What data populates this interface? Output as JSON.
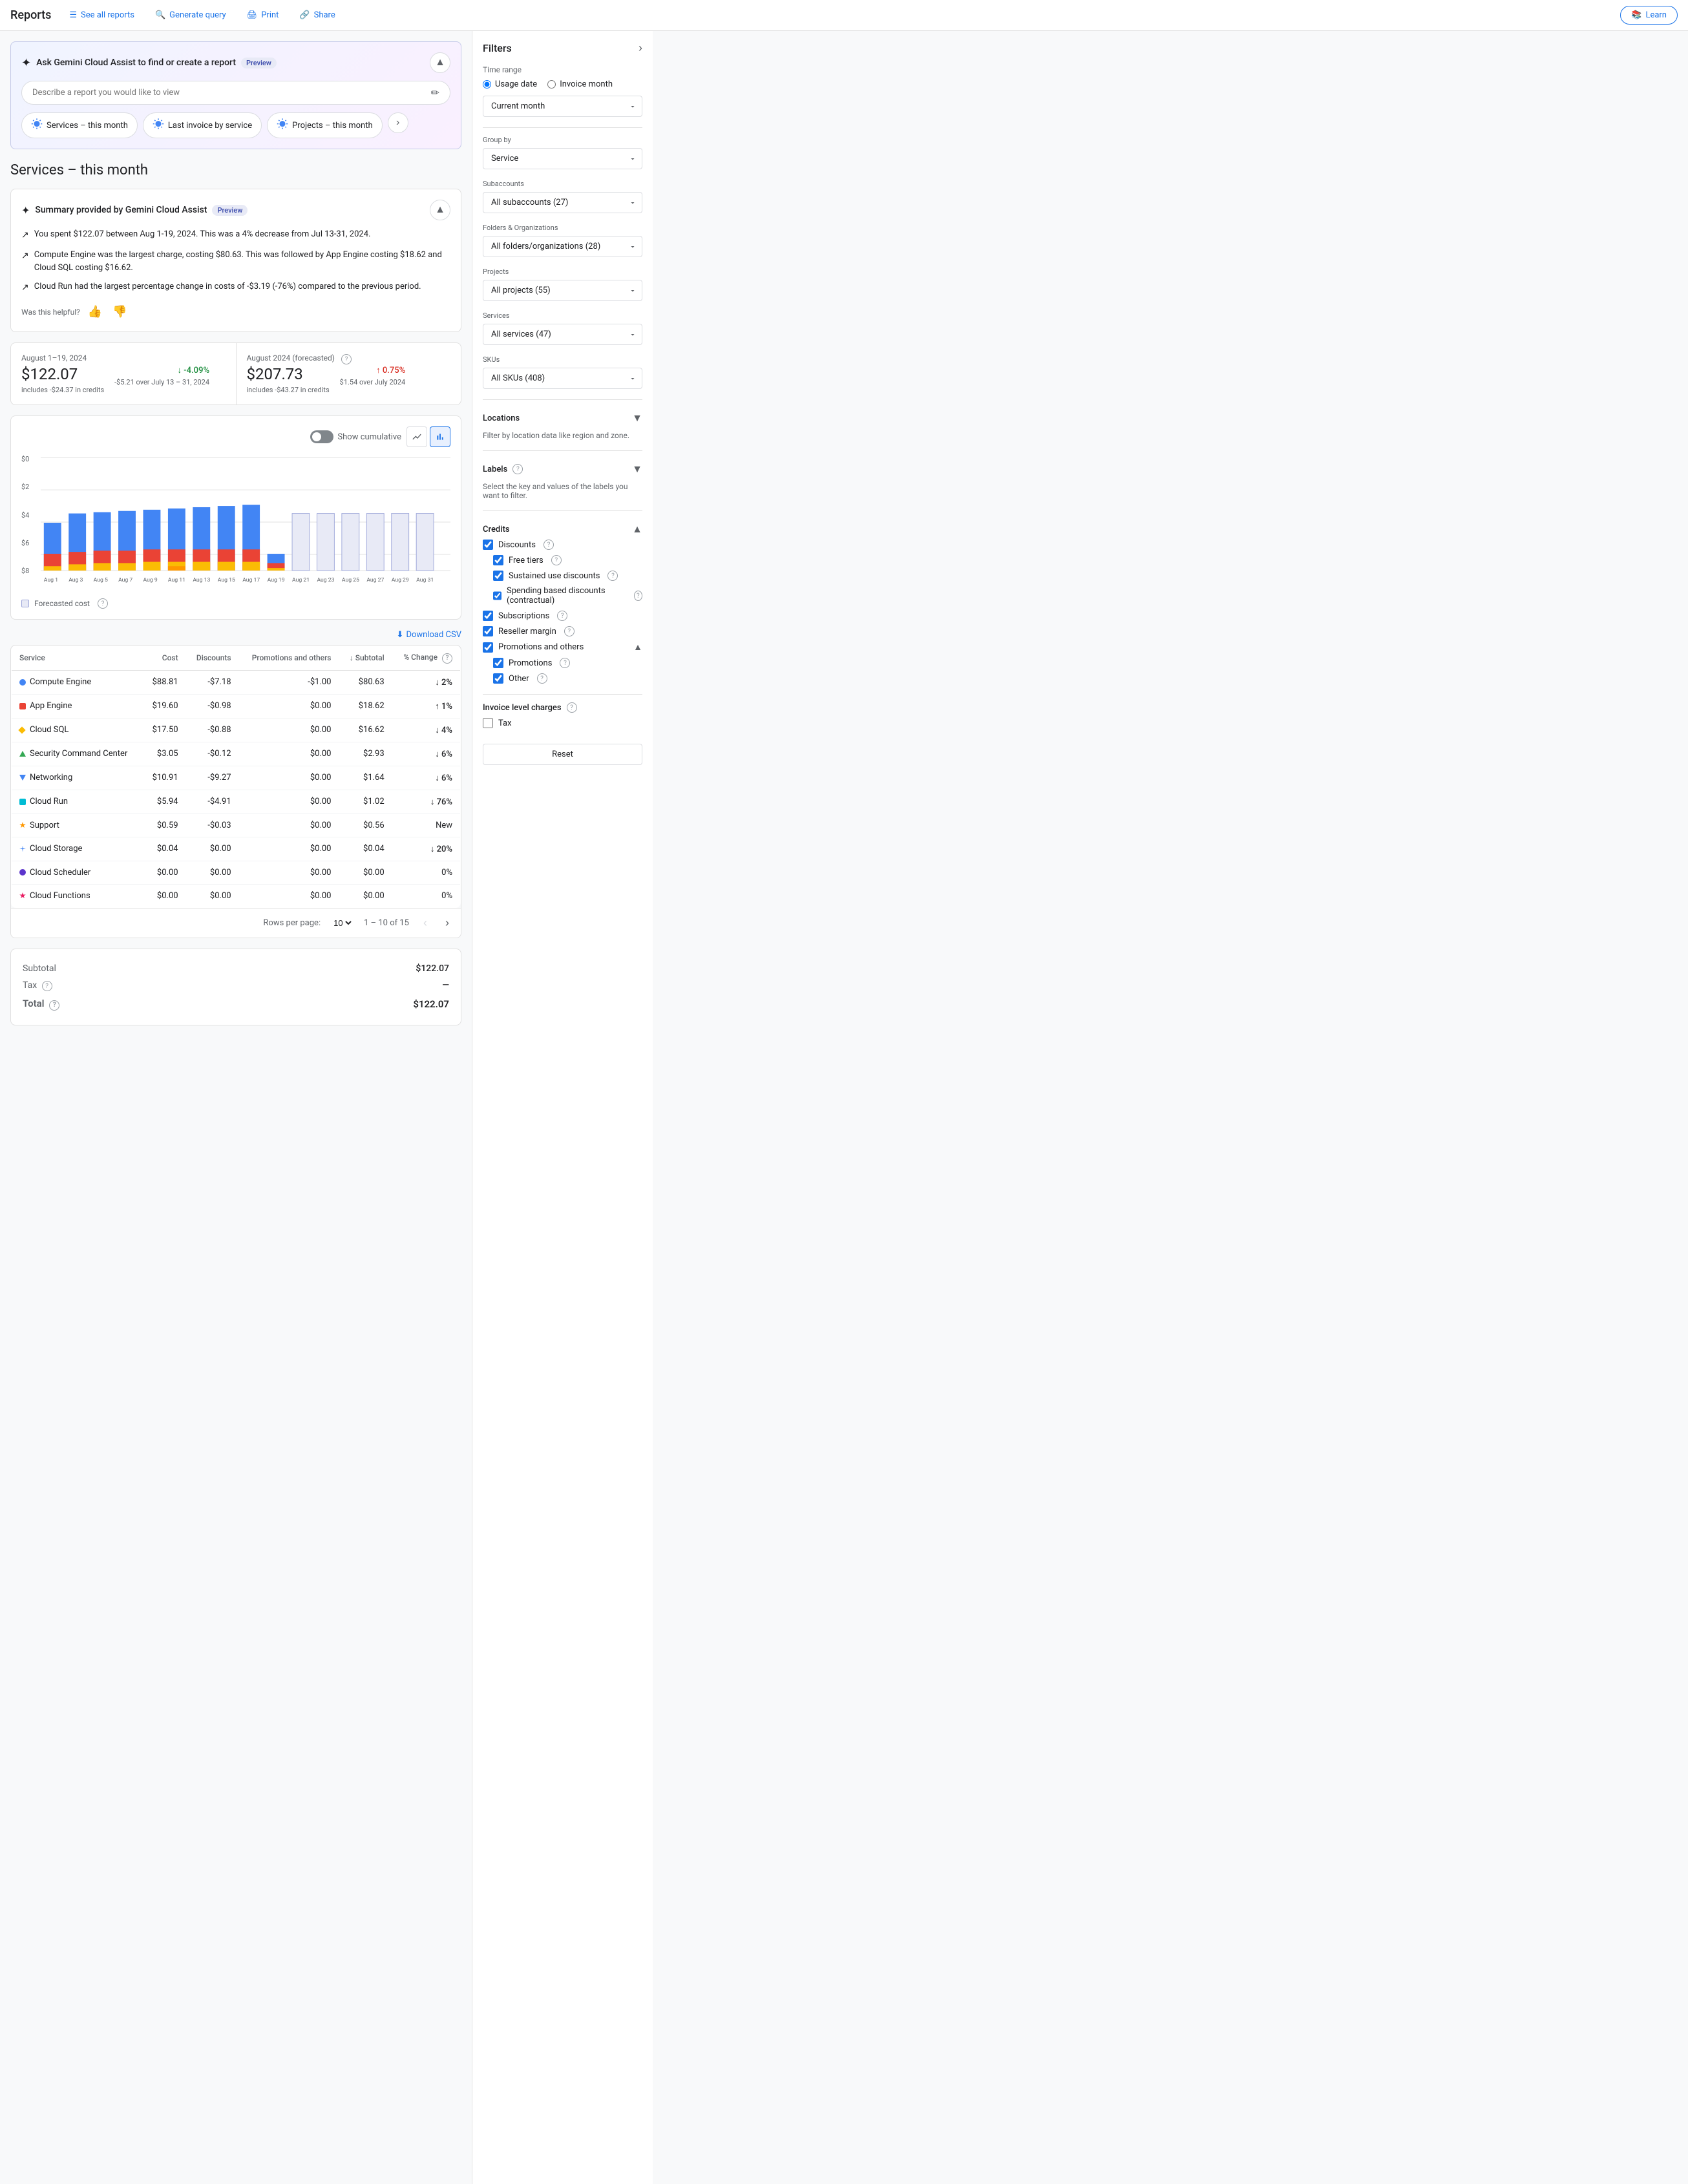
{
  "nav": {
    "title": "Reports",
    "see_all": "See all reports",
    "generate": "Generate query",
    "print": "Print",
    "share": "Share",
    "learn": "Learn"
  },
  "gemini": {
    "title": "Ask Gemini Cloud Assist to find or create a report",
    "badge": "Preview",
    "placeholder": "Describe a report you would like to view",
    "quick_links": [
      {
        "label": "Services – this month",
        "icon": "☁"
      },
      {
        "label": "Last invoice by service",
        "icon": "☁"
      },
      {
        "label": "Projects – this month",
        "icon": "☁"
      }
    ]
  },
  "page_title": "Services – this month",
  "summary": {
    "title": "Summary provided by Gemini Cloud Assist",
    "badge": "Preview",
    "bullets": [
      "You spent $122.07 between Aug 1-19, 2024. This was a 4% decrease from Jul 13-31, 2024.",
      "Compute Engine was the largest charge, costing $80.63. This was followed by App Engine costing $18.62 and Cloud SQL costing $16.62.",
      "Cloud Run had the largest percentage change in costs of -$3.19 (-76%) compared to the previous period."
    ],
    "helpful_label": "Was this helpful?"
  },
  "stats": {
    "current": {
      "date": "August 1–19, 2024",
      "amount": "$122.07",
      "sub": "includes -$24.37 in credits",
      "change": "↓ -4.09%",
      "change_dir": "down",
      "change_sub": "-$5.21 over July 13 – 31, 2024"
    },
    "forecast": {
      "date": "August 2024 (forecasted)",
      "amount": "$207.73",
      "sub": "includes -$43.27 in credits",
      "change": "↑ 0.75%",
      "change_dir": "up",
      "change_sub": "$1.54 over July 2024"
    }
  },
  "chart": {
    "y_labels": [
      "$8",
      "$6",
      "$4",
      "$2",
      "$0"
    ],
    "x_labels": [
      "Aug 1",
      "Aug 3",
      "Aug 5",
      "Aug 7",
      "Aug 9",
      "Aug 11",
      "Aug 13",
      "Aug 15",
      "Aug 17",
      "Aug 19",
      "Aug 21",
      "Aug 23",
      "Aug 25",
      "Aug 27",
      "Aug 29",
      "Aug 31"
    ],
    "show_cumulative": "Show cumulative",
    "legend_forecasted": "Forecasted cost",
    "download_csv": "Download CSV"
  },
  "table": {
    "headers": [
      "Service",
      "Cost",
      "Discounts",
      "Promotions and others",
      "Subtotal",
      "% Change"
    ],
    "rows": [
      {
        "service": "Compute Engine",
        "cost": "$88.81",
        "discounts": "-$7.18",
        "promotions": "-$1.00",
        "subtotal": "$80.63",
        "change": "↓ 2%",
        "change_dir": "down",
        "dot_color": "#4285f4",
        "dot_shape": "circle"
      },
      {
        "service": "App Engine",
        "cost": "$19.60",
        "discounts": "-$0.98",
        "promotions": "$0.00",
        "subtotal": "$18.62",
        "change": "↑ 1%",
        "change_dir": "up",
        "dot_color": "#ea4335",
        "dot_shape": "square"
      },
      {
        "service": "Cloud SQL",
        "cost": "$17.50",
        "discounts": "-$0.88",
        "promotions": "$0.00",
        "subtotal": "$16.62",
        "change": "↓ 4%",
        "change_dir": "down",
        "dot_color": "#fbbc04",
        "dot_shape": "diamond"
      },
      {
        "service": "Security Command Center",
        "cost": "$3.05",
        "discounts": "-$0.12",
        "promotions": "$0.00",
        "subtotal": "$2.93",
        "change": "↓ 6%",
        "change_dir": "down",
        "dot_color": "#34a853",
        "dot_shape": "triangle"
      },
      {
        "service": "Networking",
        "cost": "$10.91",
        "discounts": "-$9.27",
        "promotions": "$0.00",
        "subtotal": "$1.64",
        "change": "↓ 6%",
        "change_dir": "down",
        "dot_color": "#4285f4",
        "dot_shape": "triangle-down"
      },
      {
        "service": "Cloud Run",
        "cost": "$5.94",
        "discounts": "-$4.91",
        "promotions": "$0.00",
        "subtotal": "$1.02",
        "change": "↓ 76%",
        "change_dir": "down",
        "dot_color": "#00bcd4",
        "dot_shape": "square"
      },
      {
        "service": "Support",
        "cost": "$0.59",
        "discounts": "-$0.03",
        "promotions": "$0.00",
        "subtotal": "$0.56",
        "change": "New",
        "change_dir": "neutral",
        "dot_color": "#ff9800",
        "dot_shape": "star"
      },
      {
        "service": "Cloud Storage",
        "cost": "$0.04",
        "discounts": "$0.00",
        "promotions": "$0.00",
        "subtotal": "$0.04",
        "change": "↓ 20%",
        "change_dir": "down",
        "dot_color": "#4285f4",
        "dot_shape": "star-4"
      },
      {
        "service": "Cloud Scheduler",
        "cost": "$0.00",
        "discounts": "$0.00",
        "promotions": "$0.00",
        "subtotal": "$0.00",
        "change": "0%",
        "change_dir": "neutral",
        "dot_color": "#5c35cc",
        "dot_shape": "circle"
      },
      {
        "service": "Cloud Functions",
        "cost": "$0.00",
        "discounts": "$0.00",
        "promotions": "$0.00",
        "subtotal": "$0.00",
        "change": "0%",
        "change_dir": "neutral",
        "dot_color": "#e91e63",
        "dot_shape": "star"
      }
    ],
    "pagination": {
      "rows_per_page": "Rows per page:",
      "per_page": "10",
      "range": "1 – 10 of 15"
    },
    "subtotal_label": "Subtotal",
    "subtotal_value": "$122.07",
    "tax_label": "Tax",
    "tax_value": "—",
    "total_label": "Total",
    "total_value": "$122.07"
  },
  "filters": {
    "title": "Filters",
    "time_range": {
      "label": "Time range",
      "usage_date": "Usage date",
      "invoice_month": "Invoice month",
      "current_month": "Current month"
    },
    "group_by": {
      "label": "Group by",
      "value": "Service"
    },
    "subaccounts": {
      "label": "Subaccounts",
      "value": "All subaccounts (27)"
    },
    "folders": {
      "label": "Folders & Organizations",
      "value": "All folders/organizations (28)"
    },
    "projects": {
      "label": "Projects",
      "value": "All projects (55)"
    },
    "services": {
      "label": "Services",
      "value": "All services (47)"
    },
    "skus": {
      "label": "SKUs",
      "value": "All SKUs (408)"
    },
    "locations": {
      "label": "Locations",
      "sub": "Filter by location data like region and zone."
    },
    "labels": {
      "label": "Labels",
      "sub": "Select the key and values of the labels you want to filter."
    },
    "credits": {
      "label": "Credits",
      "discounts": {
        "label": "Discounts",
        "checked": true,
        "children": [
          {
            "label": "Free tiers",
            "checked": true
          },
          {
            "label": "Sustained use discounts",
            "checked": true
          },
          {
            "label": "Spending based discounts (contractual)",
            "checked": true
          }
        ]
      },
      "subscriptions": {
        "label": "Subscriptions",
        "checked": true
      },
      "reseller_margin": {
        "label": "Reseller margin",
        "checked": true
      },
      "promotions": {
        "label": "Promotions and others",
        "checked": true,
        "children": [
          {
            "label": "Promotions",
            "checked": true
          },
          {
            "label": "Other",
            "checked": true
          }
        ]
      }
    },
    "invoice_charges": {
      "label": "Invoice level charges",
      "tax": {
        "label": "Tax",
        "checked": false
      }
    },
    "reset": "Reset"
  }
}
